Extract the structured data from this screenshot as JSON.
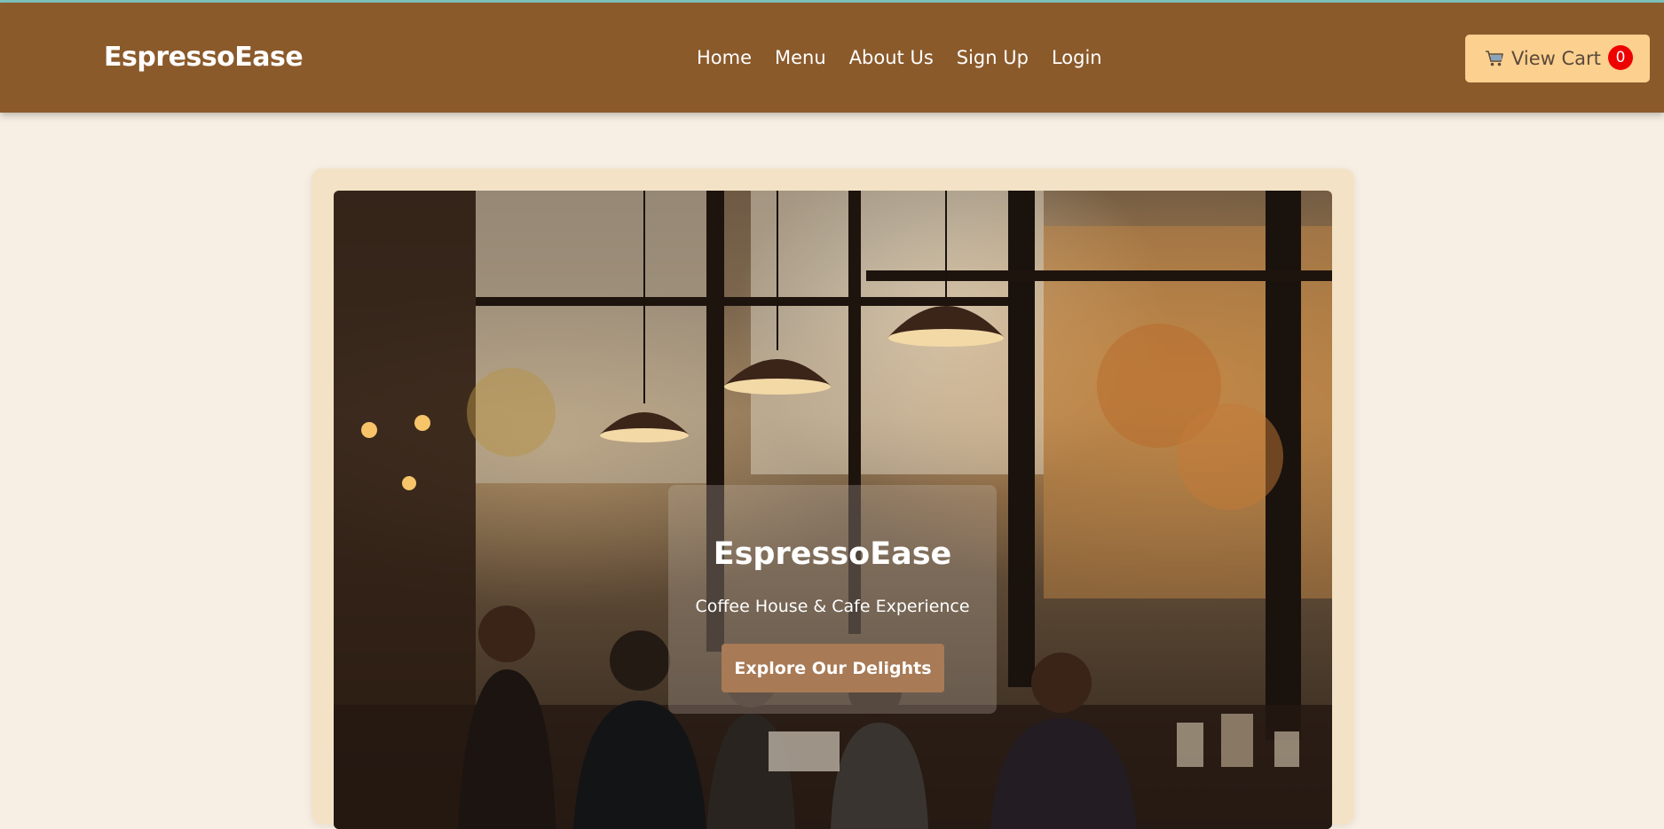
{
  "header": {
    "brand": "EspressoEase",
    "nav": [
      {
        "label": "Home"
      },
      {
        "label": "Menu"
      },
      {
        "label": "About Us"
      },
      {
        "label": "Sign Up"
      },
      {
        "label": "Login"
      }
    ],
    "cart": {
      "label": "View Cart",
      "count": "0",
      "icon": "cart-icon"
    }
  },
  "hero": {
    "title": "EspressoEase",
    "subtitle": "Coffee House & Cafe Experience",
    "cta_label": "Explore Our Delights"
  },
  "colors": {
    "navbar": "#8b5a2b",
    "page_background": "#f7efe3",
    "cart_button": "#fcd08f",
    "cart_badge": "#ee0000",
    "cta_button": "#a87a55",
    "hero_frame": "#f3e2c5"
  }
}
